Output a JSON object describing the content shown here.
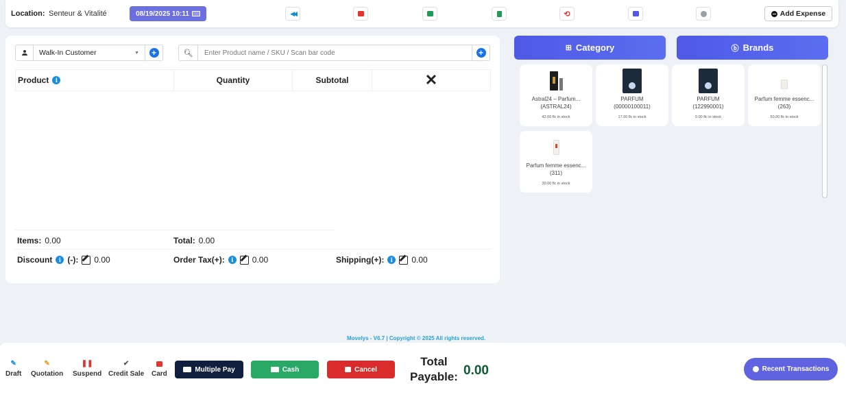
{
  "header": {
    "location_label": "Location:",
    "location_value": "Senteur & Vitalité",
    "datetime": "08/19/2025 10:11",
    "tools": [
      {
        "name": "back-icon",
        "color": "#0d8bd6"
      },
      {
        "name": "close-window-icon",
        "color": "#e3342f"
      },
      {
        "name": "briefcase-icon",
        "color": "#1e9b58"
      },
      {
        "name": "calculator-icon",
        "color": "#1e9b58"
      },
      {
        "name": "undo-icon",
        "color": "#e3342f"
      },
      {
        "name": "credit-card-icon",
        "color": "#4f59e6"
      },
      {
        "name": "settings-icon",
        "color": "#9aa0a8"
      }
    ],
    "add_expense": "Add Expense"
  },
  "pos": {
    "customer": "Walk-In Customer",
    "search_placeholder": "Enter Product name / SKU / Scan bar code",
    "columns": {
      "product": "Product",
      "quantity": "Quantity",
      "subtotal": "Subtotal",
      "remove": "✕"
    },
    "items_label": "Items:",
    "items_value": "0.00",
    "total_label": "Total:",
    "total_value": "0.00",
    "discount_label": "Discount",
    "discount_suffix": "(-):",
    "discount_value": "0.00",
    "tax_label": "Order Tax(+):",
    "tax_value": "0.00",
    "shipping_label": "Shipping(+):",
    "shipping_value": "0.00"
  },
  "catalog": {
    "category_label": "Category",
    "brands_label": "Brands",
    "products": [
      {
        "name": "Astral24 – Parfum...",
        "code": "(ASTRAL24)",
        "stock": "42.00 flc in stock"
      },
      {
        "name": "PARFUM",
        "code": "(00000100011)",
        "stock": "17.00 flc in stock"
      },
      {
        "name": "PARFUM",
        "code": "(122990001)",
        "stock": "0.00 flc in stock"
      },
      {
        "name": "Parfum femme essenc...",
        "code": "(263)",
        "stock": "50.00 flc in stock"
      },
      {
        "name": "Parfum femme essenc...",
        "code": "(311)",
        "stock": "30.00 flc in stock"
      }
    ]
  },
  "footer": {
    "copyright": "Movelys - V6.7 | Copyright © 2025 All rights reserved."
  },
  "bottom": {
    "draft": "Draft",
    "quotation": "Quotation",
    "suspend": "Suspend",
    "credit_sale": "Credit Sale",
    "card": "Card",
    "multiple_pay": "Multiple Pay",
    "cash": "Cash",
    "cancel": "Cancel",
    "total_payable_line1": "Total",
    "total_payable_line2": "Payable:",
    "total_payable_value": "0.00",
    "recent_transactions": "Recent Transactions"
  }
}
